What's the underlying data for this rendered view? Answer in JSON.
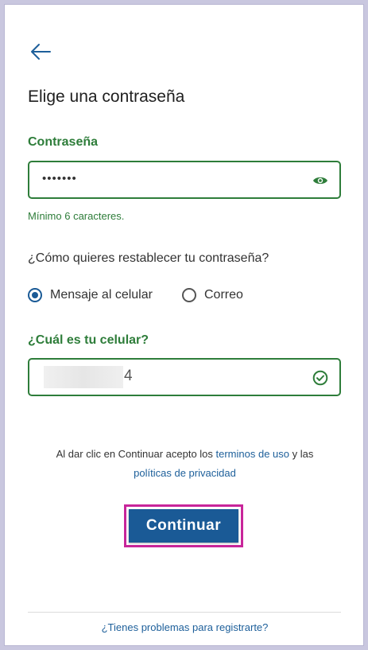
{
  "header": {
    "title": "Elige una contraseña"
  },
  "password": {
    "label": "Contraseña",
    "value": "•••••••",
    "hint": "Mínimo 6 caracteres."
  },
  "reset": {
    "question": "¿Cómo quieres restablecer tu contraseña?",
    "options": [
      {
        "label": "Mensaje al celular",
        "selected": true
      },
      {
        "label": "Correo",
        "selected": false
      }
    ]
  },
  "phone": {
    "label": "¿Cuál es tu celular?",
    "visible_digit": "4"
  },
  "terms": {
    "prefix": "Al dar clic en Continuar acepto los ",
    "terms_link": "terminos de uso",
    "middle": " y las",
    "privacy_link": "políticas de privacidad"
  },
  "actions": {
    "continue_label": "Continuar",
    "help_link": "¿Tienes problemas para registrarte?"
  },
  "colors": {
    "accent_green": "#2e7d3a",
    "primary_blue": "#1a5a96",
    "highlight_magenta": "#c8259a"
  },
  "icons": {
    "back": "arrow-left-icon",
    "show_password": "eye-icon",
    "valid": "check-circle-icon"
  }
}
